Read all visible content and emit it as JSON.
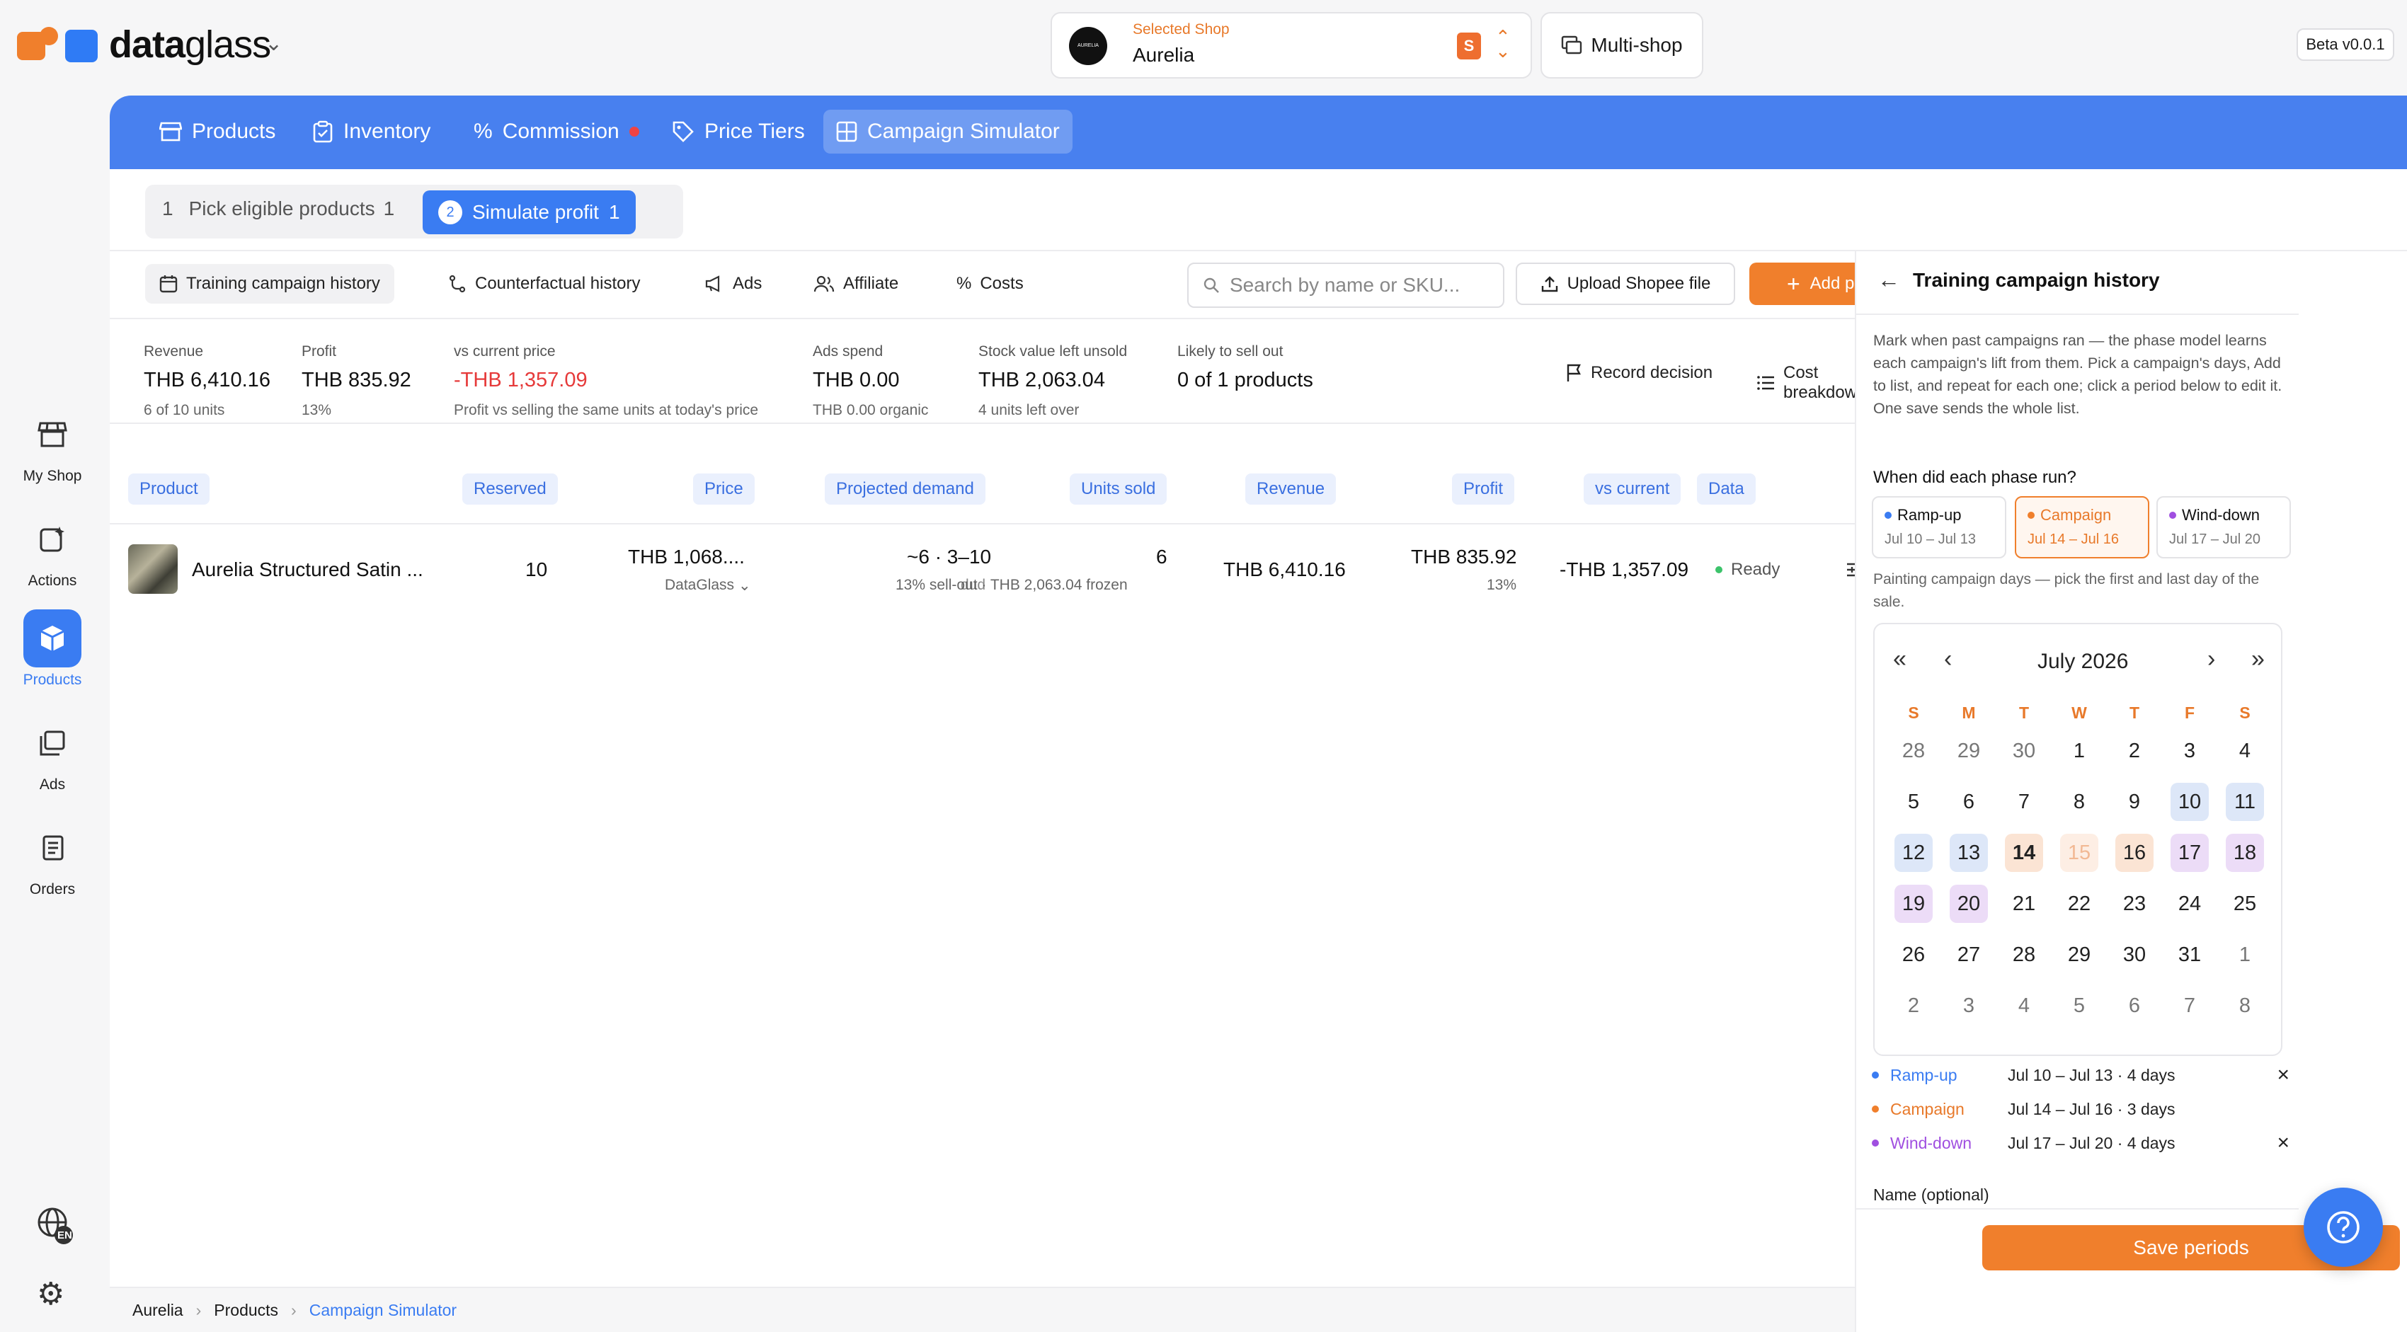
{
  "app": {
    "brand_bold": "data",
    "brand_thin": "glass",
    "beta": "Beta v0.0.1"
  },
  "shop": {
    "caption": "Selected Shop",
    "name": "Aurelia",
    "avatar_text": "AURELIA",
    "multishop_label": "Multi-shop"
  },
  "rail": [
    {
      "label": "My Shop",
      "icon": "store-icon"
    },
    {
      "label": "Actions",
      "icon": "actions-icon"
    },
    {
      "label": "Products",
      "icon": "box-icon",
      "active": true
    },
    {
      "label": "Ads",
      "icon": "ads-icon"
    },
    {
      "label": "Orders",
      "icon": "orders-icon"
    }
  ],
  "language": "EN",
  "nav": [
    {
      "label": "Products"
    },
    {
      "label": "Inventory"
    },
    {
      "label": "Commission"
    },
    {
      "label": "Price Tiers"
    },
    {
      "label": "Campaign Simulator",
      "active": true
    }
  ],
  "steps": {
    "s1_num": "1",
    "s1_label": "Pick eligible products",
    "s1_count": "1",
    "s2_num": "2",
    "s2_label": "Simulate profit",
    "s2_count": "1"
  },
  "subtabs": [
    {
      "label": "Training campaign history",
      "active": true
    },
    {
      "label": "Counterfactual history"
    },
    {
      "label": "Ads"
    },
    {
      "label": "Affiliate"
    },
    {
      "label": "Costs"
    }
  ],
  "search": {
    "placeholder": "Search by name or SKU..."
  },
  "buttons": {
    "upload": "Upload Shopee file",
    "add": "Add products",
    "record": "Record decision",
    "cost": "Cost breakdown",
    "save": "Save periods"
  },
  "metrics": {
    "revenue": {
      "label": "Revenue",
      "value": "THB 6,410.16",
      "sub": "6 of 10 units"
    },
    "profit": {
      "label": "Profit",
      "value": "THB 835.92",
      "sub": "13%"
    },
    "vs_current": {
      "label": "vs current price",
      "value": "-THB 1,357.09",
      "sub": "Profit vs selling the same units at today's price"
    },
    "ads": {
      "label": "Ads spend",
      "value": "THB 0.00",
      "sub": "THB 0.00 organic"
    },
    "stock": {
      "label": "Stock value left unsold",
      "value": "THB 2,063.04",
      "sub": "4 units left over"
    },
    "sellout": {
      "label": "Likely to sell out",
      "value": "0 of 1 products"
    }
  },
  "table": {
    "headers": [
      "Product",
      "Reserved",
      "Price",
      "Projected demand",
      "Units sold",
      "Revenue",
      "Profit",
      "vs current",
      "Data"
    ],
    "row": {
      "product": "Aurelia Structured Satin ...",
      "reserved": "10",
      "price": "THB 1,068....",
      "price_source": "DataGlass",
      "demand": "~6 · 3–10",
      "demand_sub": "13% sell-out · THB 2,063.04 frozen",
      "demand_overlap": "dud",
      "units": "6",
      "revenue": "THB 6,410.16",
      "profit": "THB 835.92",
      "profit_sub": "13%",
      "vs_current": "-THB 1,357.09",
      "status": "Ready"
    }
  },
  "panel": {
    "title": "Training campaign history",
    "description": "Mark when past campaigns ran — the phase model learns each campaign's lift from them. Pick a campaign's days, Add to list, and repeat for each one; click a period below to edit it. One save sends the whole list.",
    "question": "When did each phase run?",
    "phases": [
      {
        "name": "Ramp-up",
        "dates": "Jul 10 – Jul 13",
        "color": "#3a7cf2"
      },
      {
        "name": "Campaign",
        "dates": "Jul 14 – Jul 16",
        "color": "#f07f2c",
        "selected": true
      },
      {
        "name": "Wind-down",
        "dates": "Jul 17 – Jul 20",
        "color": "#a04fe0"
      }
    ],
    "hint": "Painting campaign days — pick the first and last day of the sale.",
    "calendar": {
      "month": "July 2026",
      "weekdays": [
        "S",
        "M",
        "T",
        "W",
        "T",
        "F",
        "S"
      ],
      "weeks": [
        [
          "28",
          "29",
          "30",
          "1",
          "2",
          "3",
          "4"
        ],
        [
          "5",
          "6",
          "7",
          "8",
          "9",
          "10",
          "11"
        ],
        [
          "12",
          "13",
          "14",
          "15",
          "16",
          "17",
          "18"
        ],
        [
          "19",
          "20",
          "21",
          "22",
          "23",
          "24",
          "25"
        ],
        [
          "26",
          "27",
          "28",
          "29",
          "30",
          "31",
          "1"
        ],
        [
          "2",
          "3",
          "4",
          "5",
          "6",
          "7",
          "8"
        ]
      ]
    },
    "periods": [
      {
        "name": "Ramp-up",
        "range": "Jul 10 – Jul 13 · 4 days",
        "color": "#3a7cf2"
      },
      {
        "name": "Campaign",
        "range": "Jul 14 – Jul 16 · 3 days",
        "color": "#f07f2c"
      },
      {
        "name": "Wind-down",
        "range": "Jul 17 – Jul 20 · 4 days",
        "color": "#a04fe0"
      }
    ],
    "name_label": "Name (optional)"
  },
  "breadcrumb": [
    "Aurelia",
    "Products",
    "Campaign Simulator"
  ],
  "colors": {
    "accent": "#4880ef",
    "orange": "#f07f2c",
    "red": "#e63a3a",
    "green": "#3cc36b"
  }
}
